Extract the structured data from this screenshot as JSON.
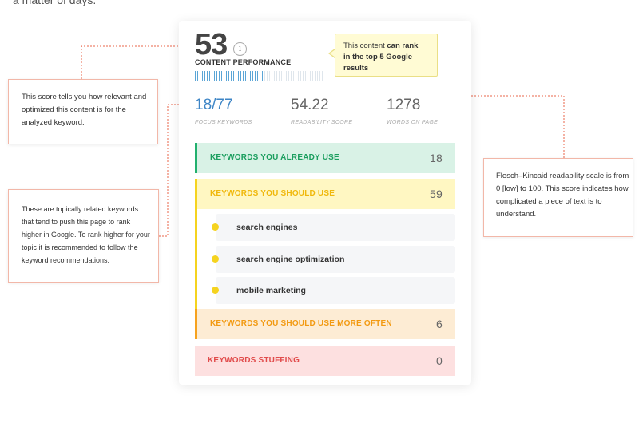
{
  "intro": {
    "text": "a matter of days."
  },
  "performance": {
    "score": "53",
    "info_glyph": "i",
    "label": "CONTENT PERFORMANCE",
    "progress": 0.53
  },
  "rank_tooltip": {
    "prefix": "This content ",
    "bold1": "can rank",
    "line2": "in the top 5 Google results"
  },
  "metrics": {
    "focus_used": "18",
    "focus_total": "77",
    "focus_label": "FOCUS KEYWORDS",
    "readability_value": "54.22",
    "readability_label": "READABILITY SCORE",
    "words_value": "1278",
    "words_label": "WORDS ON PAGE"
  },
  "keyword_groups": {
    "already_use": {
      "label": "KEYWORDS YOU ALREADY USE",
      "count": "18"
    },
    "should_use": {
      "label": "KEYWORDS YOU SHOULD USE",
      "count": "59"
    },
    "more_often": {
      "label": "KEYWORDS YOU SHOULD USE MORE OFTEN",
      "count": "6"
    },
    "stuffing": {
      "label": "KEYWORDS STUFFING",
      "count": "0"
    }
  },
  "suggested_keywords": [
    "search engines",
    "search engine optimization",
    "mobile marketing"
  ],
  "notes": {
    "score_note": "This score tells you how relevant and optimized this content is for the analyzed keyword.",
    "topics_note": "These are topically related keywords that tend to push this page to rank higher in Google. To rank higher for your topic it is recommended to follow the keyword recommendations.",
    "readability_note": "Flesch–Kincaid readability scale is from 0 [low] to 100. This score indicates how complicated a piece of text is to understand."
  },
  "colors": {
    "green": "#22b06e",
    "yellow": "#f5d31f",
    "orange": "#f6a21e",
    "red": "#e14b4b",
    "connector": "#e8644a"
  }
}
